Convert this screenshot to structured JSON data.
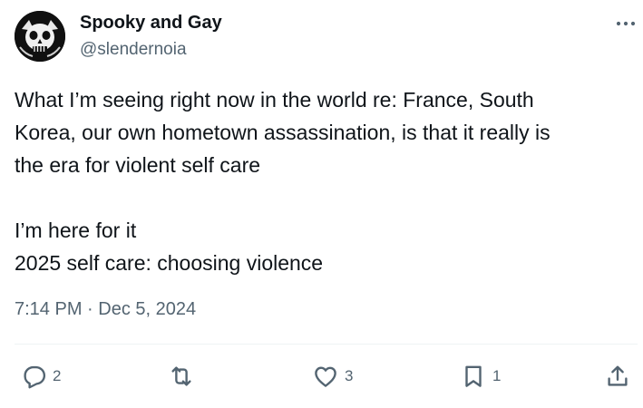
{
  "author": {
    "display_name": "Spooky and Gay",
    "handle": "@slendernoia"
  },
  "tweet": {
    "lines_paragraph_1": [
      "What I’m seeing right now in the world re: France, South",
      "Korea, our own hometown assassination, is that it really is",
      "the era for violent self care"
    ],
    "lines_paragraph_2": [
      "I’m here for it",
      "2025 self care: choosing violence"
    ],
    "timestamp": "7:14 PM · Dec 5, 2024"
  },
  "actions": {
    "reply": {
      "icon": "reply-icon",
      "count": "2"
    },
    "repost": {
      "icon": "repost-icon",
      "count": ""
    },
    "like": {
      "icon": "heart-icon",
      "count": "3"
    },
    "bookmark": {
      "icon": "bookmark-icon",
      "count": "1"
    },
    "share": {
      "icon": "share-icon"
    }
  },
  "colors": {
    "text_primary": "#0f1419",
    "text_secondary": "#536471",
    "divider": "#eff3f4"
  }
}
